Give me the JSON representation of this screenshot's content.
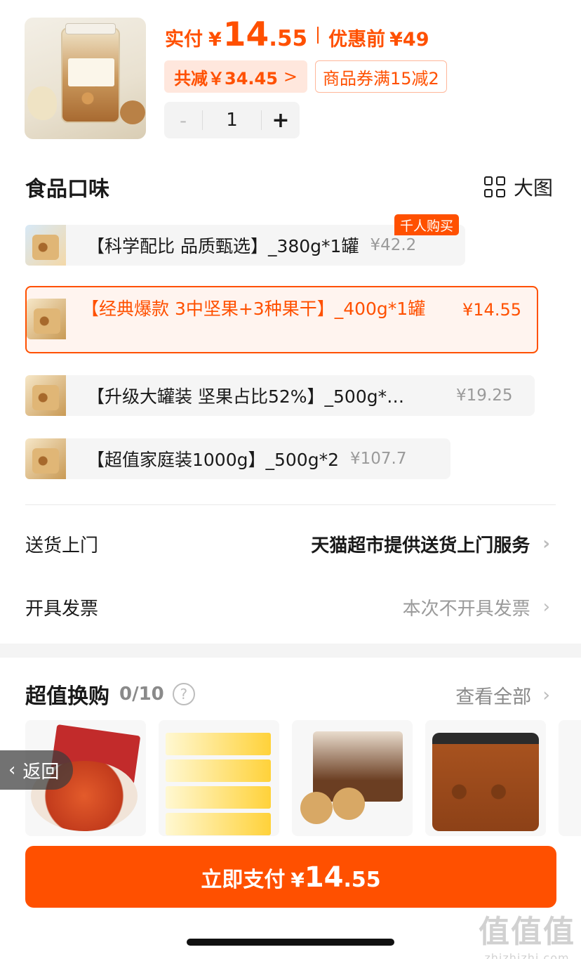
{
  "header": {
    "paid_label": "实付",
    "currency": "¥",
    "price_int": "14",
    "price_dec": ".55",
    "orig_label": "优惠前",
    "orig_price": "¥49",
    "promo_text": "共减￥34.45",
    "promo_chevron": ">",
    "coupon_text": "商品券满15减2",
    "qty_minus": "-",
    "qty_value": "1",
    "qty_plus": "+"
  },
  "flavor": {
    "title": "食品口味",
    "big_view_label": "大图",
    "badge": "千人购买",
    "options": [
      {
        "name": "【科学配比 品质甄选】_380g*1罐",
        "price": "¥42.2"
      },
      {
        "name": "【经典爆款 3中坚果+3种果干】_400g*1罐",
        "price": "¥14.55",
        "selected": true
      },
      {
        "name": "【升级大罐装 坚果占比52%】_500g*…",
        "price": "¥19.25"
      },
      {
        "name": "【超值家庭装1000g】_500g*2",
        "price": "¥107.7"
      }
    ]
  },
  "delivery": {
    "label": "送货上门",
    "value": "天猫超市提供送货上门服务",
    "chevron": "›"
  },
  "invoice": {
    "label": "开具发票",
    "value": "本次不开具发票",
    "chevron": "›"
  },
  "swap": {
    "title": "超值换购",
    "count": "0/10",
    "help": "?",
    "view_all": "查看全部",
    "chevron": "›"
  },
  "back_label": "返回",
  "back_arrow": "‹",
  "pay": {
    "label": "立即支付",
    "currency": "¥",
    "int": "14",
    "dec": ".55"
  },
  "watermark": {
    "line1": "值值值",
    "line2": "zhizhizhi.com"
  },
  "colors": {
    "accent": "#ff5000",
    "promo_bg": "#ffe7dd"
  }
}
